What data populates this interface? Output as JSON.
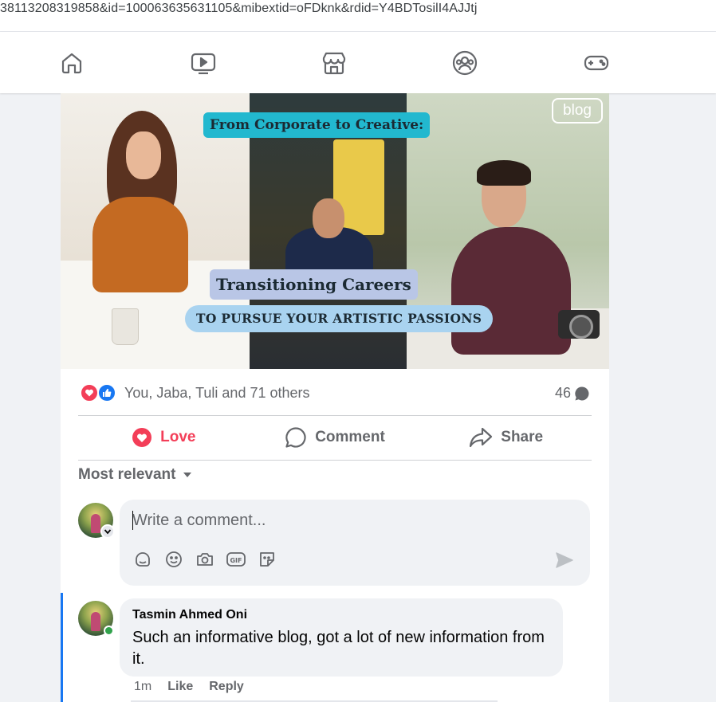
{
  "browser": {
    "url": "38113208319858&id=100063635631105&mibextid=oFDknk&rdid=Y4BDTosilI4AJJtj"
  },
  "nav": {
    "items": [
      {
        "name": "home"
      },
      {
        "name": "video"
      },
      {
        "name": "marketplace"
      },
      {
        "name": "groups"
      },
      {
        "name": "gaming"
      }
    ]
  },
  "post": {
    "image": {
      "banner_top": "From Corporate to Creative:",
      "banner_middle": "Transitioning Careers",
      "banner_bottom": "TO PURSUE YOUR ARTISTIC PASSIONS",
      "logo_text": "blog"
    },
    "reactions": {
      "names": "You, Jaba, Tuli and 71 others",
      "comment_count": "46"
    },
    "actions": {
      "love": "Love",
      "comment": "Comment",
      "share": "Share"
    },
    "sort_label": "Most relevant",
    "composer": {
      "placeholder": "Write a comment..."
    },
    "comment": {
      "author": "Tasmin Ahmed Oni",
      "text": "Such an informative blog, got a lot of new information from it.",
      "time": "1m",
      "like": "Like",
      "reply": "Reply"
    }
  },
  "colors": {
    "accent": "#1877f2",
    "love": "#f33e58",
    "online": "#31a24c"
  }
}
